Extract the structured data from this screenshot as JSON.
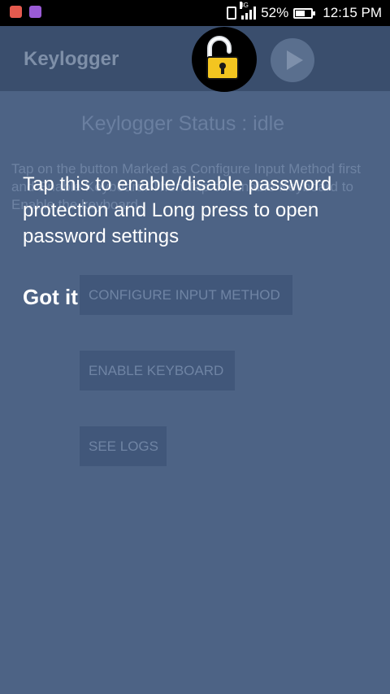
{
  "status_bar": {
    "network_type": "3G",
    "battery": "52%",
    "time": "12:15 PM",
    "icons": [
      "notification-app-icon",
      "notification-gallery-icon",
      "vibrate-icon",
      "signal-icon",
      "battery-icon"
    ]
  },
  "toolbar": {
    "title": "Keylogger",
    "lock_icon": "padlock-open-icon",
    "play_icon": "play-icon"
  },
  "content": {
    "status": "Keylogger Status : idle",
    "instructions": "Tap on the button Marked as Configure Input Method first and Enable Keyboard. Then Tap on Enable Keyboard to Enable the keyboard.",
    "buttons": {
      "configure": "CONFIGURE INPUT METHOD",
      "enable": "ENABLE KEYBOARD",
      "logs": "SEE LOGS"
    }
  },
  "showcase": {
    "tip": "Tap this to enable/disable password protection and Long press to open password settings",
    "dismiss": "Got it"
  },
  "colors": {
    "overlay_bg": "#4d6385",
    "toolbar_bg": "#3a4e6d",
    "lock_body": "#f3c520",
    "text_white": "#ffffff"
  }
}
